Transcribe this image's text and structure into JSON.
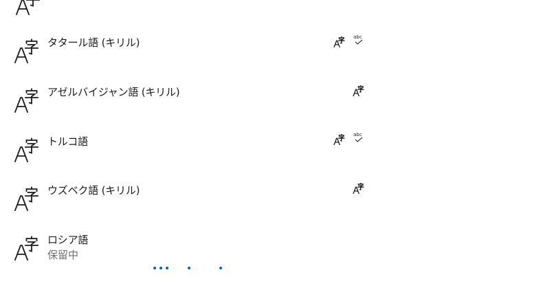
{
  "colors": {
    "text": "#1b1b1b",
    "secondary_text": "#707070",
    "accent": "#0067c0",
    "background": "#ffffff"
  },
  "languages": [
    {
      "name": "タタール語 (キリル)",
      "status": "",
      "features": [
        "language-pack-icon",
        "spell-check-icon"
      ]
    },
    {
      "name": "アゼルバイジャン語 (キリル)",
      "status": "",
      "features": [
        "language-pack-icon"
      ]
    },
    {
      "name": "トルコ語",
      "status": "",
      "features": [
        "language-pack-icon",
        "spell-check-icon"
      ]
    },
    {
      "name": "ウズベク語 (キリル)",
      "status": "",
      "features": [
        "language-pack-icon"
      ]
    },
    {
      "name": "ロシア語",
      "status": "保留中",
      "features": []
    }
  ],
  "icons": {
    "row_icon": "language-icon",
    "feature_language_pack": "language-pack-icon",
    "feature_spell_check": "spell-check-icon",
    "spell_check_text": "abc",
    "progress_indicator": "progress-dots"
  }
}
